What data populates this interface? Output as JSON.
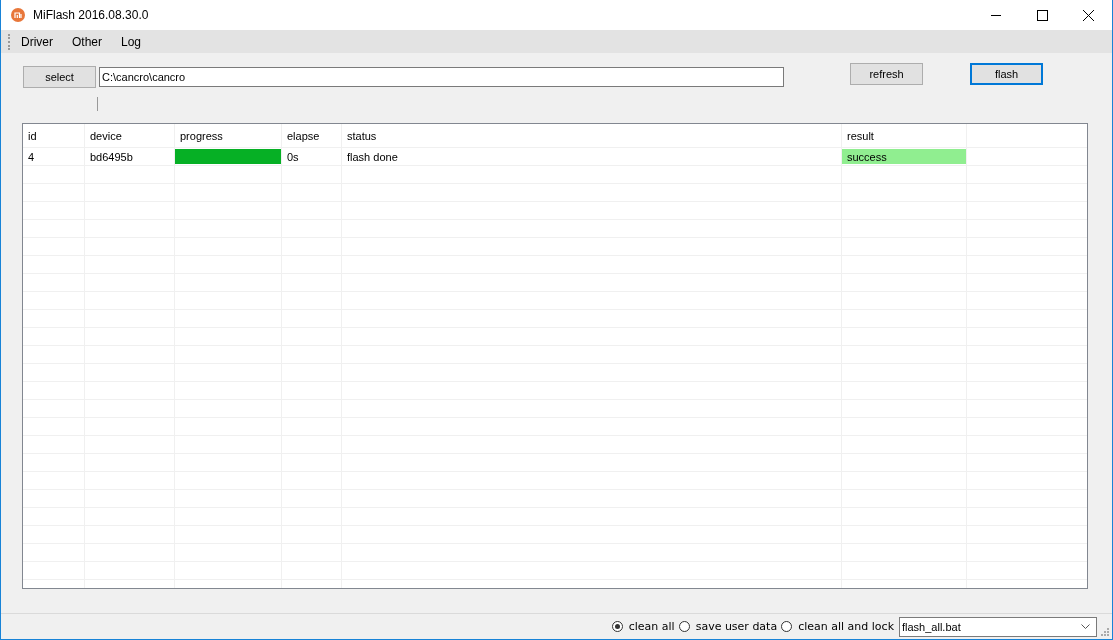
{
  "window": {
    "title": "MiFlash 2016.08.30.0"
  },
  "menu": [
    {
      "label": "Driver"
    },
    {
      "label": "Other"
    },
    {
      "label": "Log"
    }
  ],
  "toolbar": {
    "select_button": "select",
    "path": {
      "value": "C:\\cancro\\cancro"
    },
    "refresh_button": "refresh",
    "flash_button": {
      "label": "flash",
      "focused": true
    }
  },
  "table": {
    "columns": [
      "id",
      "device",
      "progress",
      "elapse",
      "status",
      "result"
    ],
    "rows": [
      {
        "id": "4",
        "device": "bd6495b",
        "progress": {
          "level": 1
        },
        "elapse": "0s",
        "status": "flash done",
        "result": {
          "text": "success",
          "color": "#90ee90"
        }
      }
    ]
  },
  "status_bar": {
    "options": [
      {
        "label": "clean all",
        "selected": true
      },
      {
        "label": "save user data",
        "selected": false
      },
      {
        "label": "clean all and lock",
        "selected": false
      }
    ],
    "script": {
      "value": "flash_all.bat"
    }
  }
}
